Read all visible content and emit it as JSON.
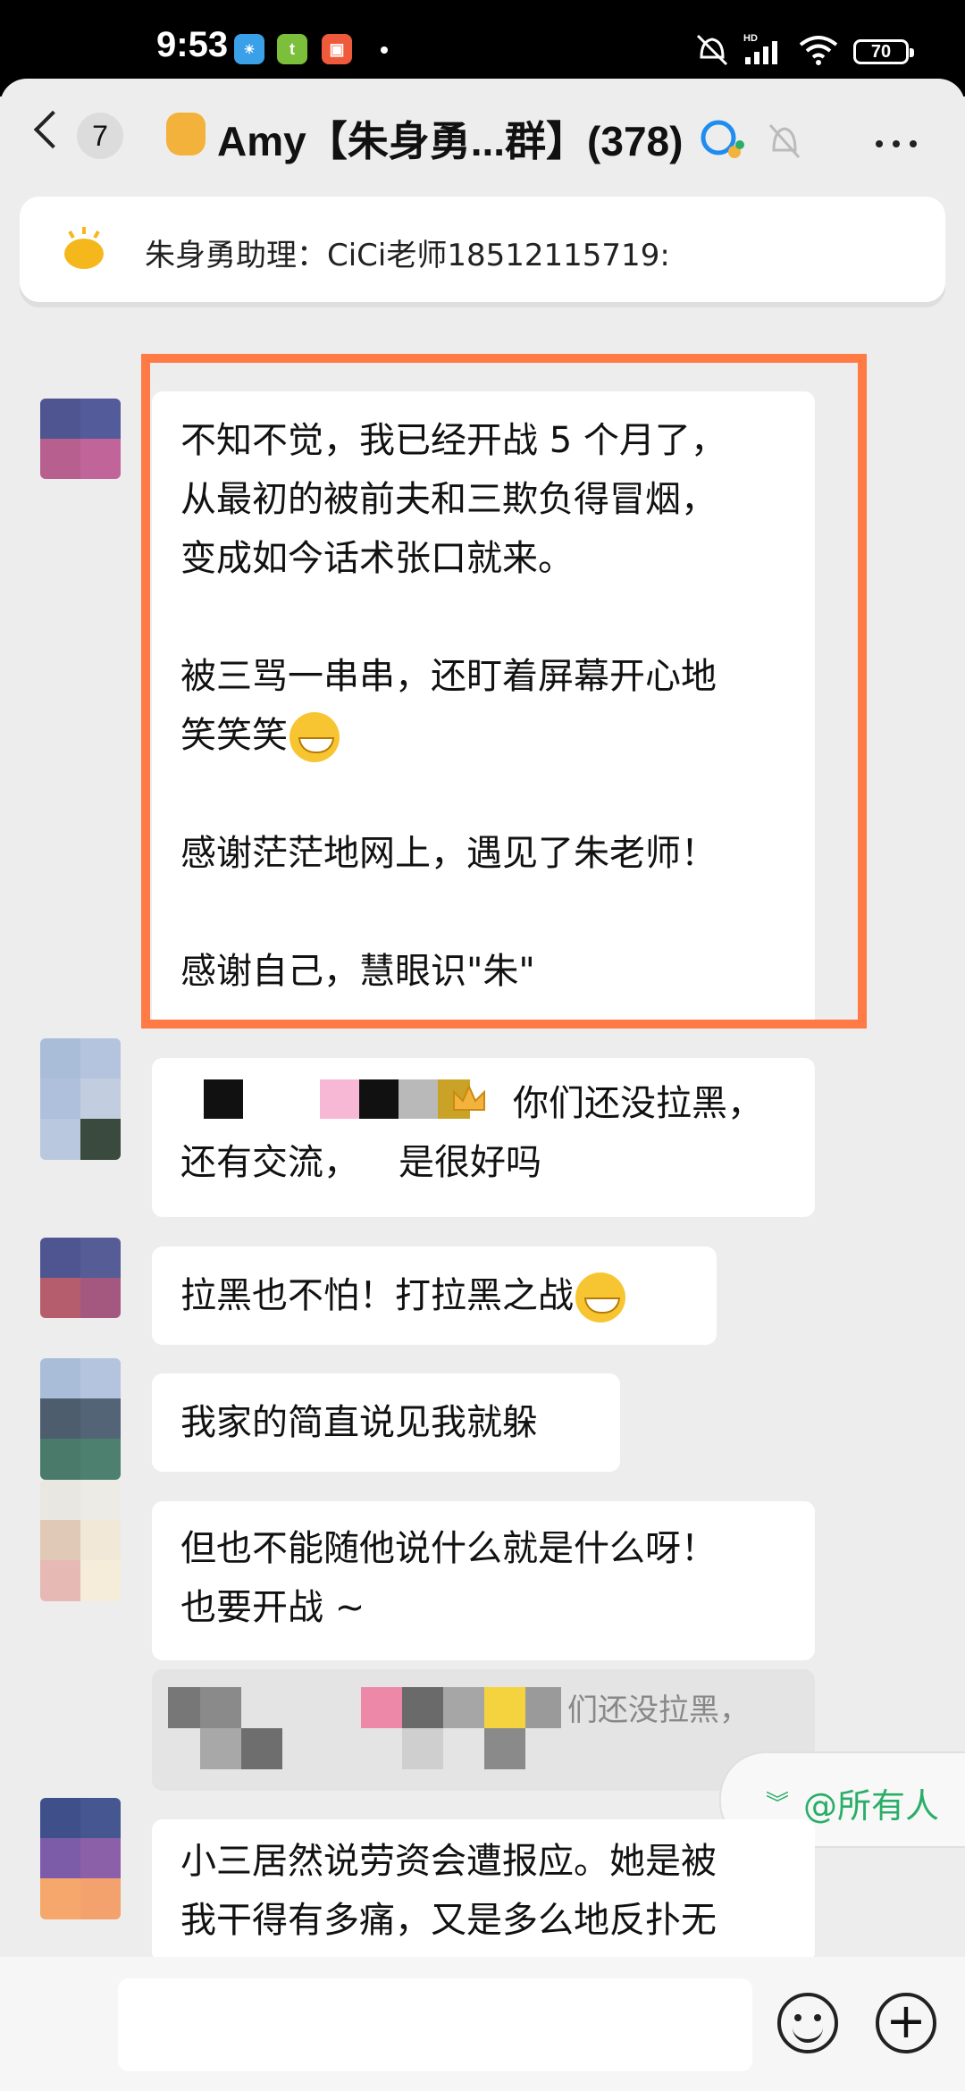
{
  "status_bar": {
    "time": "9:53",
    "battery": "70"
  },
  "header": {
    "back_count": "7",
    "title": "Amy【朱身勇...群】(378)"
  },
  "notice": {
    "text": "朱身勇助理：CiCi老师18512115719:"
  },
  "messages": {
    "m1": {
      "para1": [
        "不知不觉，我已经开战 5 个月了，",
        "从最初的被前夫和三欺负得冒烟，",
        "变成如今话术张口就来。"
      ],
      "para2": [
        "被三骂一串串，还盯着屏幕开心地",
        "笑笑笑"
      ],
      "para3": "感谢茫茫地网上，遇见了朱老师！",
      "para4": "感谢自己，慧眼识\"朱\""
    },
    "m2": {
      "line1": "你们还没拉黑，",
      "line2": "还有交流，",
      "line2b": "是很好吗"
    },
    "m3": {
      "text": "拉黑也不怕！打拉黑之战"
    },
    "m4": {
      "text": "我家的简直说见我就躲"
    },
    "m5": {
      "line1": "但也不能随他说什么就是什么呀！",
      "line2": "也要开战 ~"
    },
    "quote": {
      "text": "们还没拉黑，"
    },
    "m6": {
      "line1": "小三居然说劳资会遭报应。她是被",
      "line2": "我干得有多痛，又是多么地反扑无"
    }
  },
  "mention": {
    "label": "@所有人"
  },
  "input": {
    "placeholder": ""
  },
  "icons": {
    "back": "back-arrow-icon",
    "title_emoji": "raised-fist-icon",
    "group": "group-chat-icon",
    "mute": "bell-muted-icon",
    "more": "more-icon",
    "notice": "announcement-icon",
    "emoji": "grinning-face-icon",
    "crown": "crown-icon",
    "mention_arrow": "chevron-double-down-icon",
    "emoji_button": "emoji-icon",
    "plus_button": "plus-icon"
  },
  "colors": {
    "highlight": "#ff7a45",
    "mention": "#2aae67",
    "background": "#ededed"
  }
}
